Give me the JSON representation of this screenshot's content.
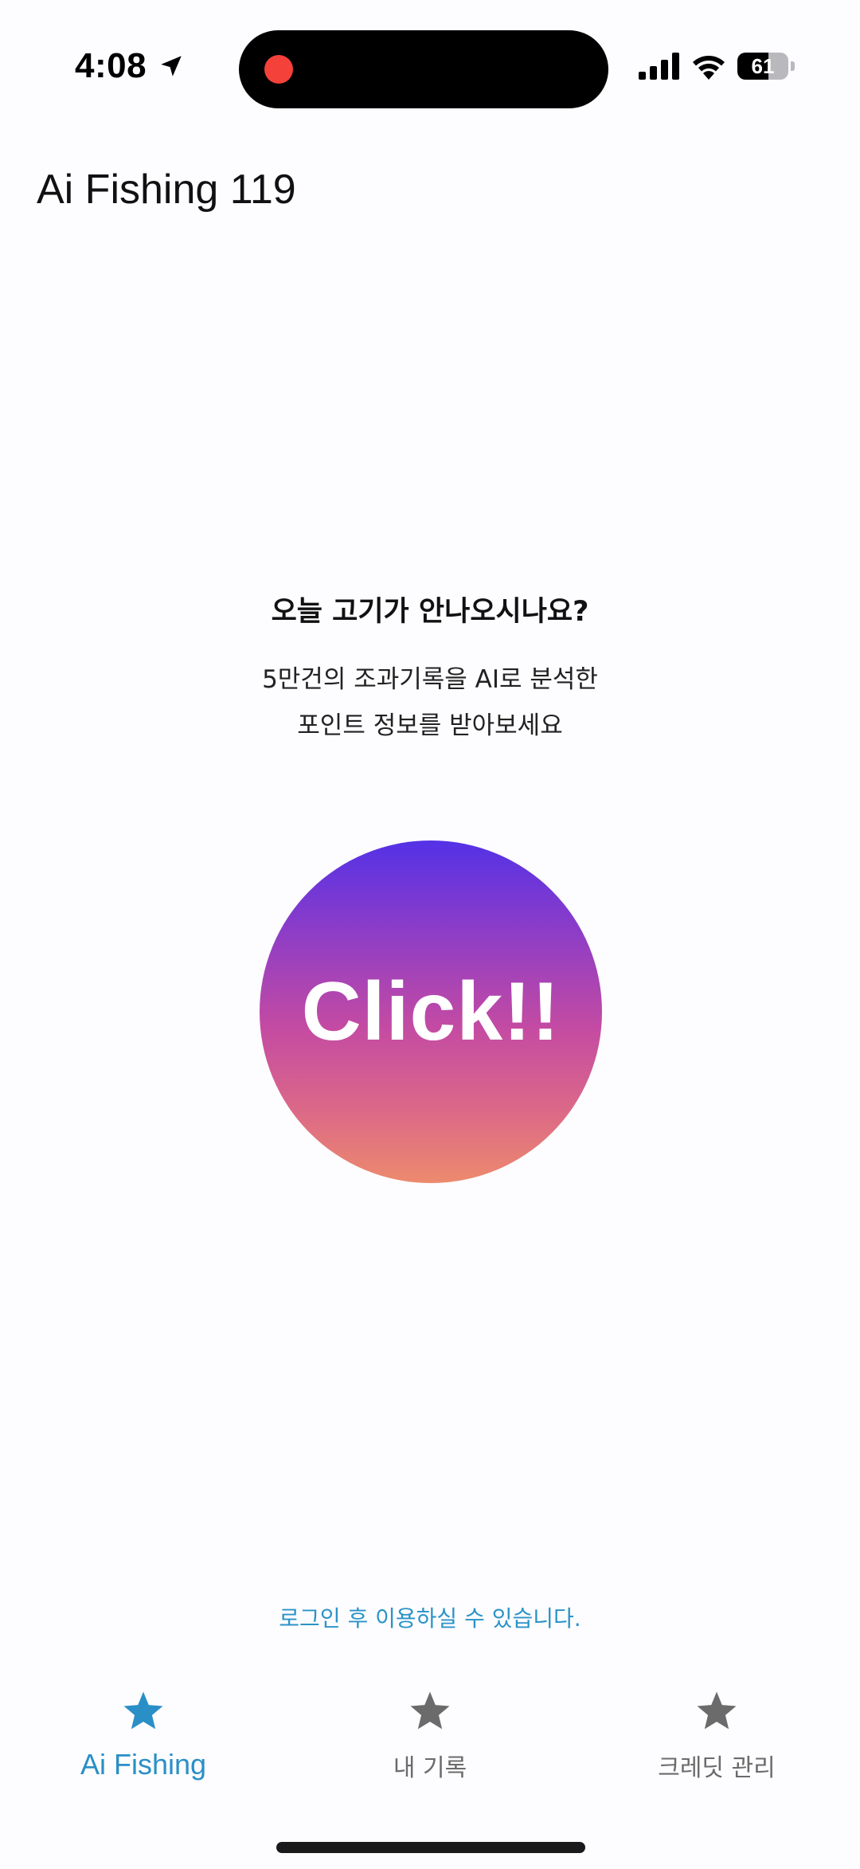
{
  "status_bar": {
    "time": "4:08",
    "location_icon": "location-arrow-icon",
    "signal_icon": "cellular-signal-icon",
    "wifi_icon": "wifi-icon",
    "battery_level": "61",
    "recording_color": "#f4413a"
  },
  "header": {
    "title": "Ai Fishing 119"
  },
  "main": {
    "headline": "오늘 고기가 안나오시나요?",
    "subtitle_line1": "5만건의 조과기록을 AI로 분석한",
    "subtitle_line2": "포인트 정보를 받아보세요",
    "click_button_label": "Click!!",
    "button_gradient": [
      "#5431e6",
      "#c44ba2",
      "#ec8a6d"
    ]
  },
  "login_notice": "로그인 후 이용하실 수 있습니다.",
  "tab_bar": {
    "active_color": "#2a8fc7",
    "inactive_color": "#6b6b6b",
    "tabs": [
      {
        "label": "Ai Fishing",
        "icon": "star-icon",
        "active": true
      },
      {
        "label": "내 기록",
        "icon": "star-icon",
        "active": false
      },
      {
        "label": "크레딧 관리",
        "icon": "star-icon",
        "active": false
      }
    ]
  }
}
